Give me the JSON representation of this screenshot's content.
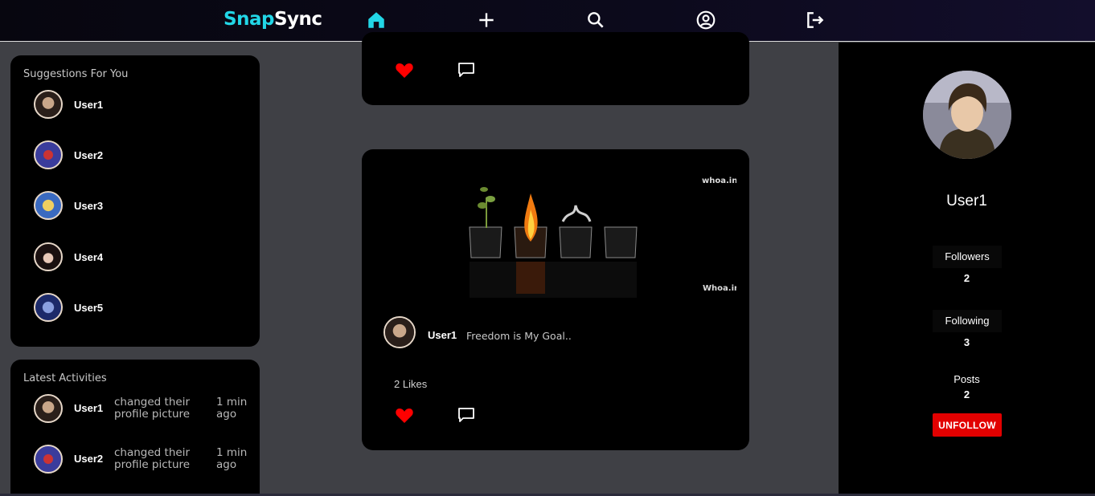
{
  "navbar": {
    "brand_part1": "Snap",
    "brand_part2": "Sync",
    "icons": [
      "home-icon",
      "plus-icon",
      "search-icon",
      "profile-icon",
      "logout-icon"
    ],
    "active_color": "#22d6e6"
  },
  "suggestions": {
    "title": "Suggestions For You",
    "users": [
      {
        "name": "User1"
      },
      {
        "name": "User2"
      },
      {
        "name": "User3"
      },
      {
        "name": "User4"
      },
      {
        "name": "User5"
      }
    ]
  },
  "activities": {
    "title": "Latest Activities",
    "items": [
      {
        "user": "User1",
        "text": "changed their profile picture",
        "time": "1 min ago"
      },
      {
        "user": "User2",
        "text": "changed their profile picture",
        "time": "1 min ago"
      }
    ]
  },
  "post": {
    "watermark_top": "whoa.in",
    "watermark_bottom": "Whoa.in",
    "author": "User1",
    "caption": "Freedom is My Goal..",
    "likes": "2 Likes",
    "liked": true
  },
  "profile": {
    "name": "User1",
    "followers_label": "Followers",
    "followers": "2",
    "following_label": "Following",
    "following": "3",
    "posts_label": "Posts",
    "posts": "2",
    "unfollow_label": "UNFOLLOW",
    "unfollow_color": "#e20000"
  },
  "colors": {
    "heart": "#ff0000",
    "accent": "#22d6e6"
  }
}
